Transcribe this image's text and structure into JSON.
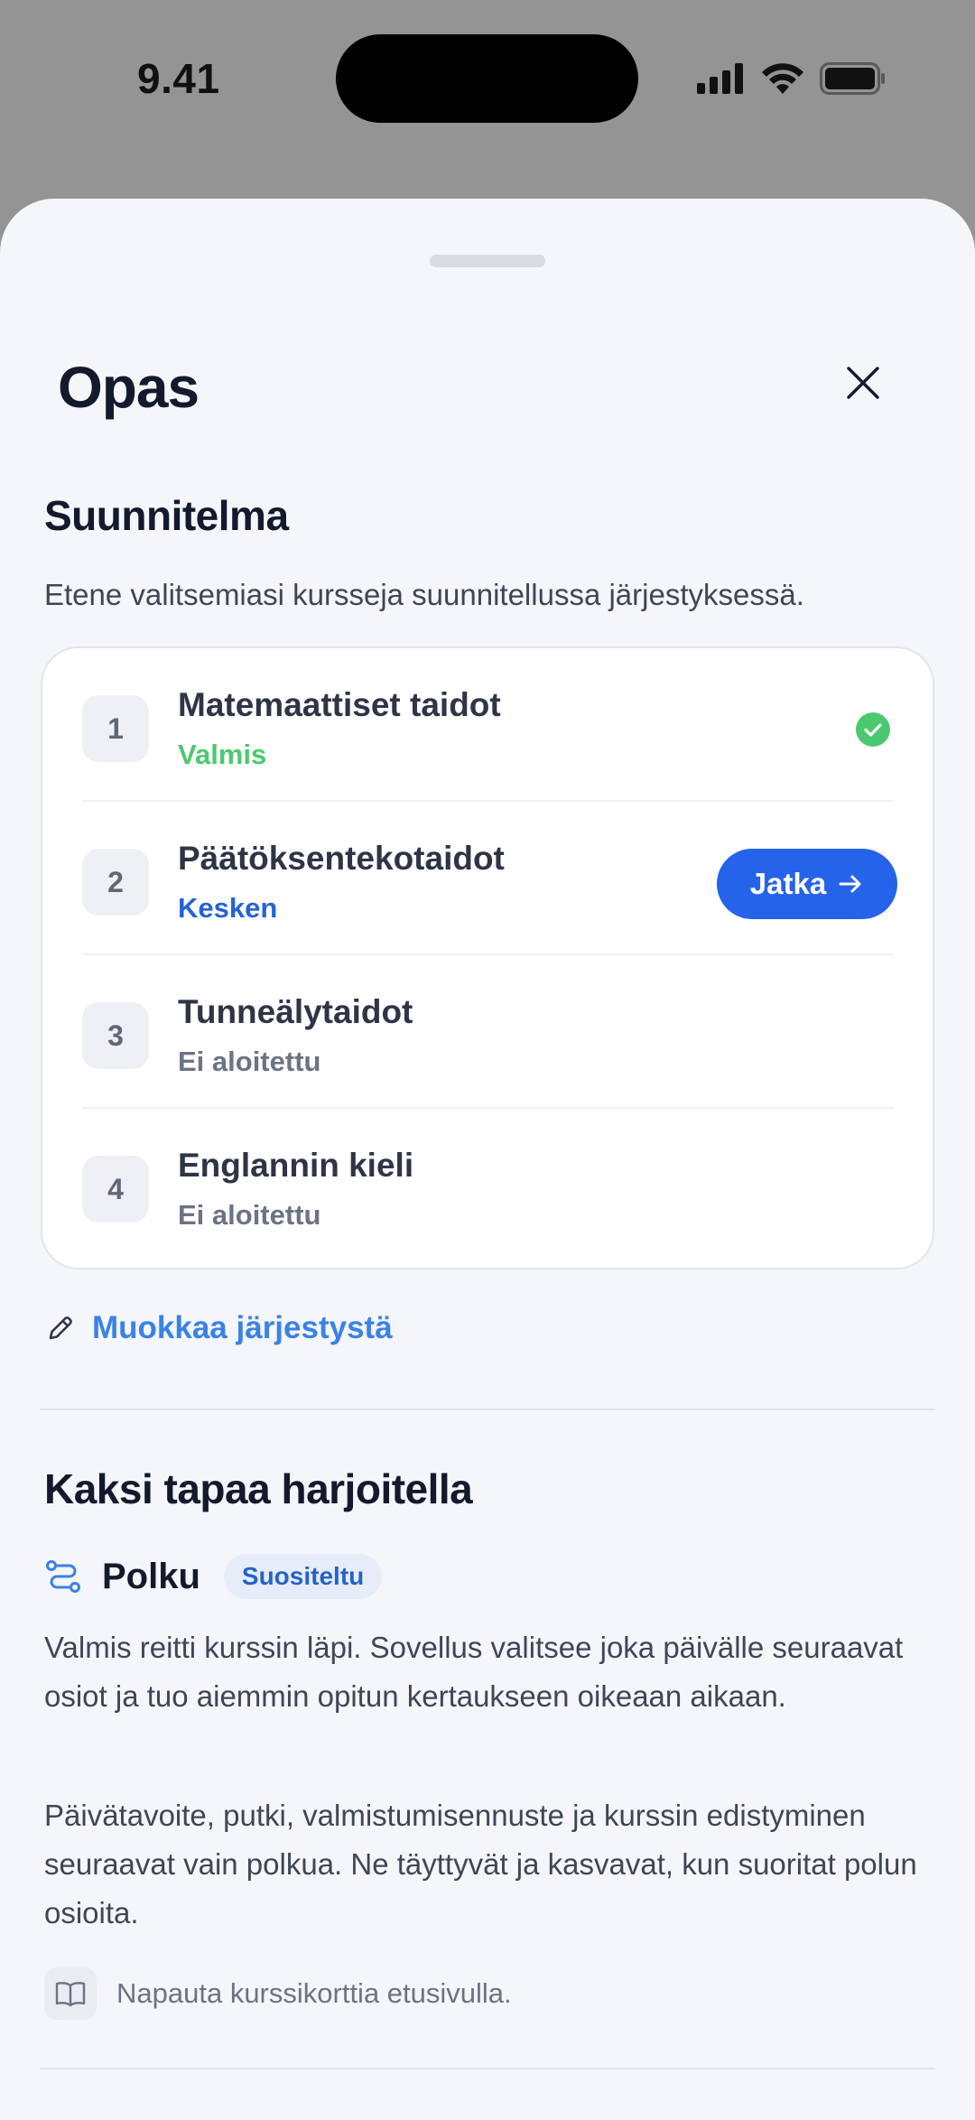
{
  "status_bar": {
    "time": "9.41"
  },
  "sheet": {
    "title": "Opas",
    "close_label": "Sulje"
  },
  "plan": {
    "title": "Suunnitelma",
    "description": "Etene valitsemiasi kursseja suunnitellussa järjestyksessä.",
    "courses": [
      {
        "number": "1",
        "name": "Matemaattiset taidot",
        "status": "Valmis",
        "status_color": "#4cc970"
      },
      {
        "number": "2",
        "name": "Päätöksentekotaidot",
        "status": "Kesken",
        "status_color": "#2563d6"
      },
      {
        "number": "3",
        "name": "Tunneälytaidot",
        "status": "Ei aloitettu",
        "status_color": "#6b7385"
      },
      {
        "number": "4",
        "name": "Englannin kieli",
        "status": "Ei aloitettu",
        "status_color": "#6b7385"
      }
    ],
    "continue_label": "Jatka",
    "edit_order_label": "Muokkaa järjestystä"
  },
  "practice": {
    "title": "Kaksi tapaa harjoitella",
    "mode_name": "Polku",
    "mode_badge": "Suositeltu",
    "paragraph_1": "Valmis reitti kurssin läpi. Sovellus valitsee joka päivälle seuraavat osiot ja tuo aiemmin opitun kertaukseen oikeaan aikaan.",
    "paragraph_2": "Päivätavoite, putki, valmistumisennuste ja kurssin edistyminen seuraavat vain polkua. Ne täyttyvät ja kasvavat, kun suoritat polun osioita.",
    "hint": "Napauta kurssikorttia etusivulla."
  },
  "colors": {
    "accent": "#2563eb",
    "link": "#3b82e6",
    "success": "#4cc970"
  }
}
